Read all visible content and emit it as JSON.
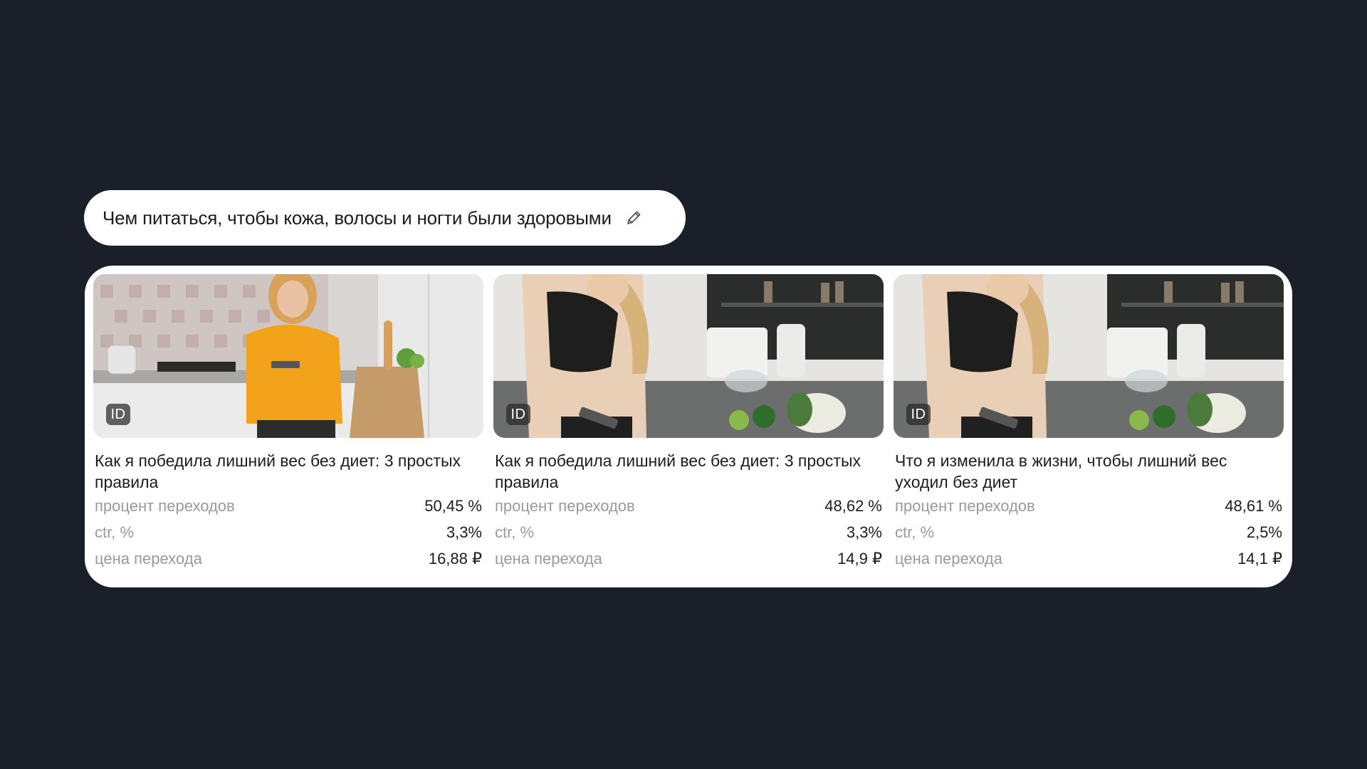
{
  "query": {
    "text": "Чем питаться, чтобы кожа, волосы и ногти были здоровыми",
    "icon": "pencil-icon"
  },
  "cards": [
    {
      "badge": "ID",
      "title": "Как я победила лишний вес без диет: 3 простых правила",
      "metrics": [
        {
          "label": "процент переходов",
          "value": "50,45 %"
        },
        {
          "label": "ctr, %",
          "value": "3,3%"
        },
        {
          "label": "цена перехода",
          "value": "16,88 ₽"
        }
      ]
    },
    {
      "badge": "ID",
      "title": "Как я победила лишний вес без диет: 3 простых правила",
      "metrics": [
        {
          "label": "процент переходов",
          "value": "48,62 %"
        },
        {
          "label": "ctr, %",
          "value": "3,3%"
        },
        {
          "label": "цена перехода",
          "value": "14,9 ₽"
        }
      ]
    },
    {
      "badge": "ID",
      "title": "Что я изменила в жизни, чтобы лишний вес уходил без диет",
      "metrics": [
        {
          "label": "процент переходов",
          "value": "48,61 %"
        },
        {
          "label": "ctr, %",
          "value": "2,5%"
        },
        {
          "label": "цена перехода",
          "value": "14,1 ₽"
        }
      ]
    }
  ]
}
